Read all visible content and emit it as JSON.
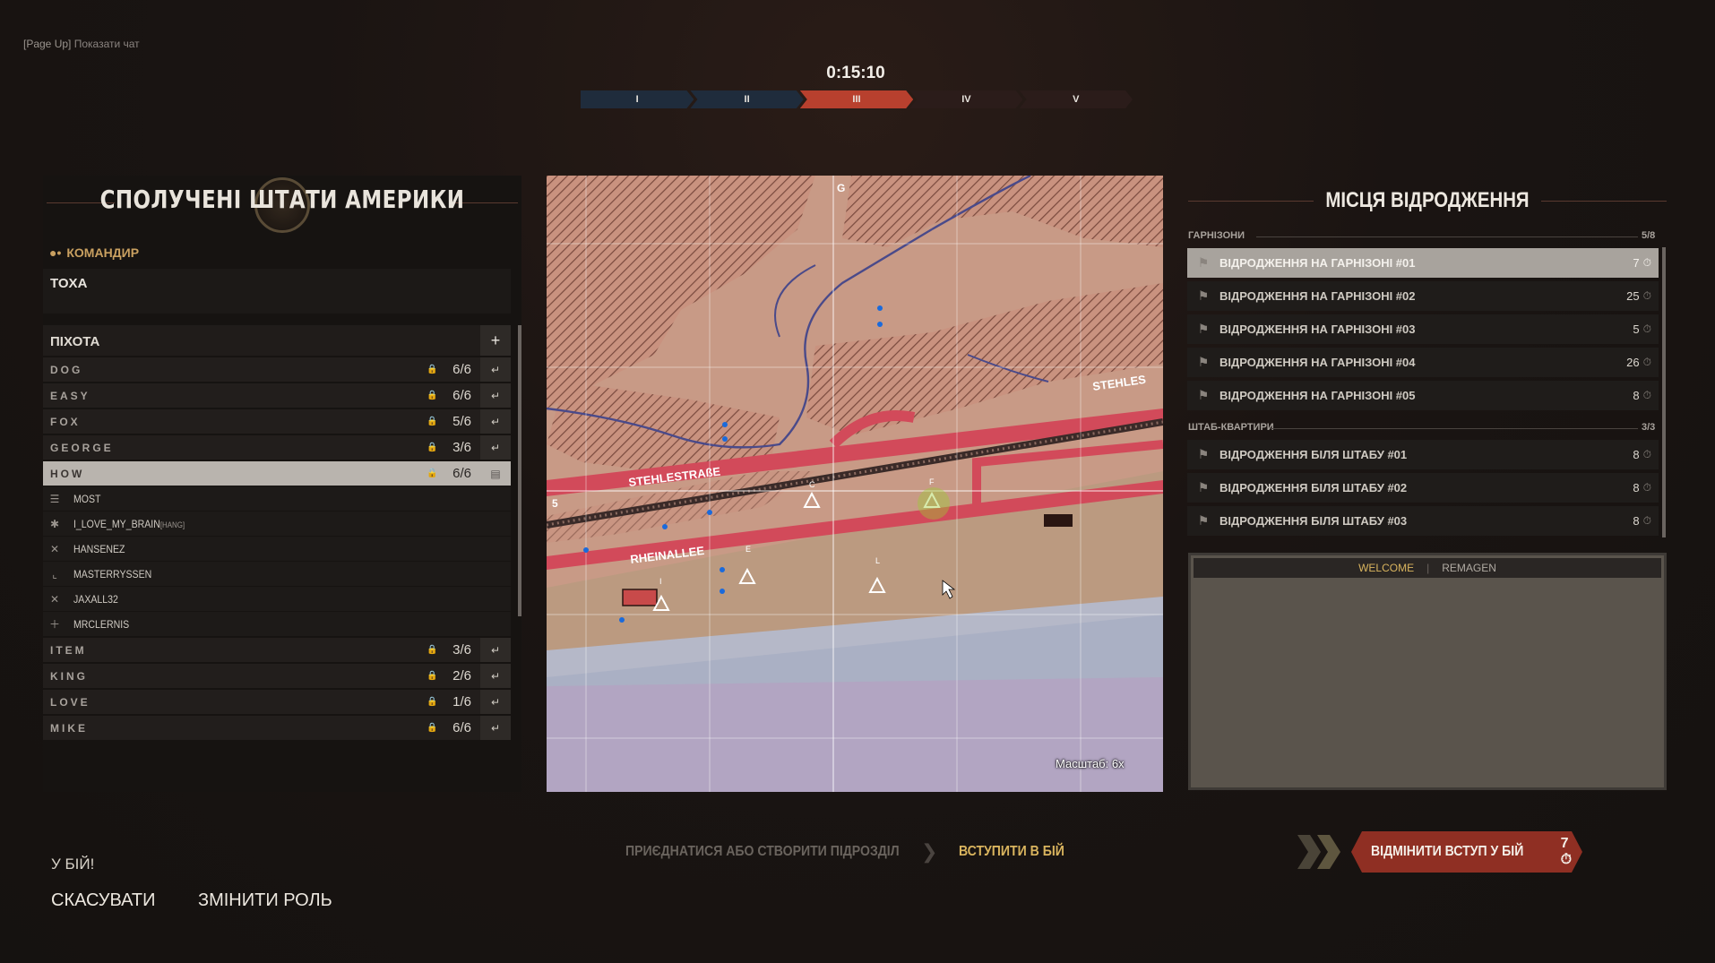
{
  "chat_hint": {
    "key": "[Page Up]",
    "label": "Показати чат"
  },
  "timer": "0:15:10",
  "sectors": [
    "I",
    "II",
    "III",
    "IV",
    "V"
  ],
  "faction": {
    "title": "СПОЛУЧЕНІ ШТАТИ АМЕРИКИ"
  },
  "commander": {
    "label": "КОМАНДИР",
    "name": "TOXA"
  },
  "infantry": {
    "label": "ПІХОТА",
    "add_label": "+"
  },
  "squads": [
    {
      "name": "DOG",
      "count": "6/6"
    },
    {
      "name": "EASY",
      "count": "6/6"
    },
    {
      "name": "FOX",
      "count": "5/6"
    },
    {
      "name": "GEORGE",
      "count": "3/6"
    },
    {
      "name": "HOW",
      "count": "6/6"
    },
    {
      "name": "ITEM",
      "count": "3/6"
    },
    {
      "name": "KING",
      "count": "2/6"
    },
    {
      "name": "LOVE",
      "count": "1/6"
    },
    {
      "name": "MIKE",
      "count": "6/6"
    }
  ],
  "members": [
    {
      "name": "MOST",
      "tag": "",
      "role_icon": "officer-icon"
    },
    {
      "name": "I_LOVE_MY_BRAIN",
      "tag": "[HANG]",
      "role_icon": "medic-icon"
    },
    {
      "name": "HANSENEZ",
      "tag": "",
      "role_icon": "rifleman-icon"
    },
    {
      "name": "MASTERRYSSEN",
      "tag": "",
      "role_icon": "engineer-icon"
    },
    {
      "name": "JAXALL32",
      "tag": "",
      "role_icon": "rifleman-icon"
    },
    {
      "name": "MRCLERNIS",
      "tag": "",
      "role_icon": "support-icon"
    }
  ],
  "map": {
    "grid_col_label": "G",
    "grid_row_label": "5",
    "road_labels": [
      "STEHLESTRAßE",
      "RHEINALLEE",
      "STEHLES"
    ],
    "point_labels": [
      "C",
      "E",
      "F",
      "I",
      "L"
    ],
    "scale_label": "Масштаб: 6x"
  },
  "spawn": {
    "title": "МІСЦЯ ВІДРОДЖЕННЯ",
    "garrisons_label": "ГАРНІЗОНИ",
    "garrisons_count": "5/8",
    "garrisons": [
      {
        "label": "ВІДРОДЖЕННЯ НА ГАРНІЗОНІ #01",
        "time": "7"
      },
      {
        "label": "ВІДРОДЖЕННЯ НА ГАРНІЗОНІ #02",
        "time": "25"
      },
      {
        "label": "ВІДРОДЖЕННЯ НА ГАРНІЗОНІ #03",
        "time": "5"
      },
      {
        "label": "ВІДРОДЖЕННЯ НА ГАРНІЗОНІ #04",
        "time": "26"
      },
      {
        "label": "ВІДРОДЖЕННЯ НА ГАРНІЗОНІ #05",
        "time": "8"
      }
    ],
    "hq_label": "ШТАБ-КВАРТИРИ",
    "hq_count": "3/3",
    "hqs": [
      {
        "label": "ВІДРОДЖЕННЯ БІЛЯ ШТАБУ #01",
        "time": "8"
      },
      {
        "label": "ВІДРОДЖЕННЯ БІЛЯ ШТАБУ #02",
        "time": "8"
      },
      {
        "label": "ВІДРОДЖЕННЯ БІЛЯ ШТАБУ #03",
        "time": "8"
      }
    ]
  },
  "info_tabs": {
    "welcome": "WELCOME",
    "separator": "|",
    "remagen": "REMAGEN"
  },
  "bottom": {
    "ready": "У БІЙ!",
    "cancel": "СКАСУВАТИ",
    "change_role": "ЗМІНИТИ РОЛЬ",
    "step_join": "ПРИЄДНАТИСЯ АБО СТВОРИТИ ПІДРОЗДІЛ",
    "step_deploy": "ВСТУПИТИ В БІЙ",
    "cancel_deploy": "ВІДМІНИТИ ВСТУП У БІЙ",
    "cancel_deploy_time": "7"
  },
  "colors": {
    "accent": "#d9b45e",
    "active_sector": "#b8402e",
    "cancel_deploy": "#8f2f23"
  }
}
